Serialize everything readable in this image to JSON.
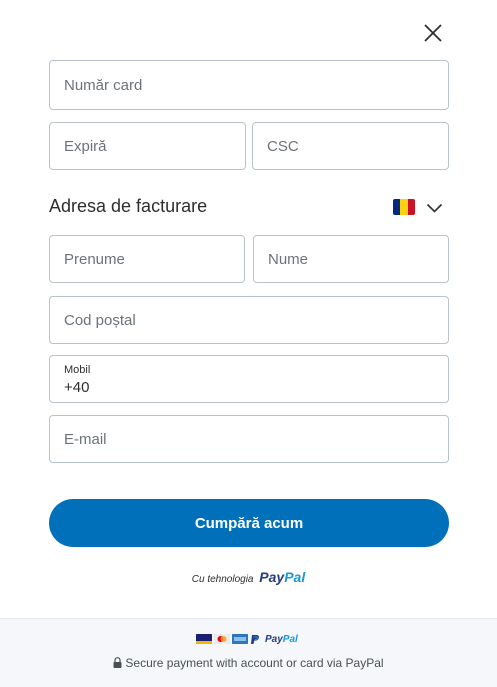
{
  "form": {
    "card_number_placeholder": "Număr card",
    "expiry_placeholder": "Expiră",
    "csc_placeholder": "CSC",
    "billing_title": "Adresa de facturare",
    "country_flag": "romania-flag",
    "first_name_placeholder": "Prenume",
    "last_name_placeholder": "Nume",
    "postal_code_placeholder": "Cod poștal",
    "mobile_label": "Mobil",
    "mobile_value": "+40",
    "email_placeholder": "E-mail"
  },
  "buy_button_label": "Cumpără acum",
  "powered": {
    "text": "Cu tehnologia",
    "brand_part1": "Pay",
    "brand_part2": "Pal"
  },
  "footer": {
    "card_icons": [
      "visa-card-icon",
      "mastercard-icon",
      "amex-card-icon",
      "paypal-p-icon"
    ],
    "brand_part1": "Pay",
    "brand_part2": "Pal",
    "secure_text": "Secure payment with account or card via PayPal"
  },
  "colors": {
    "primary": "#0070ba",
    "paypal_dark": "#253b80",
    "paypal_light": "#179bd7",
    "border": "#b9c4c9",
    "footer_bg": "#f5f7fa",
    "flag_blue": "#002b7f",
    "flag_yellow": "#fcd116",
    "flag_red": "#ce1126"
  }
}
